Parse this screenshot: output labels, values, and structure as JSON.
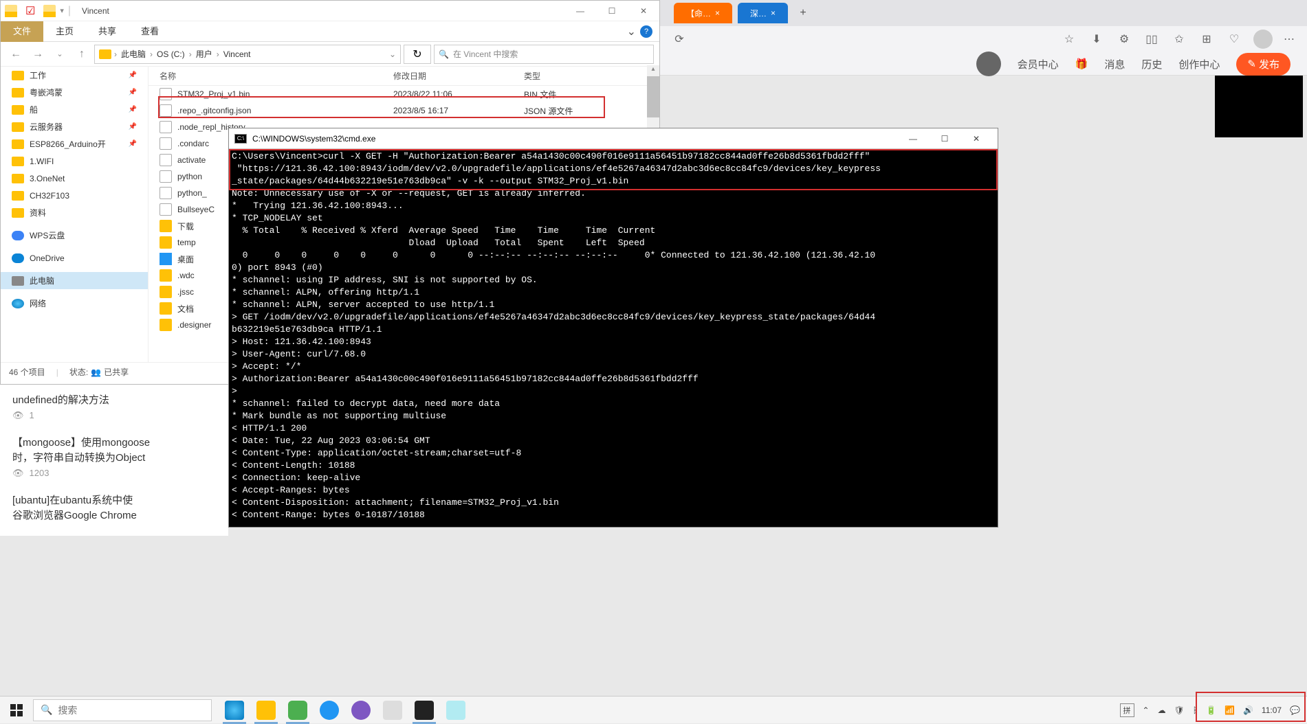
{
  "explorer": {
    "title": "Vincent",
    "ribbon": {
      "file": "文件",
      "home": "主页",
      "share": "共享",
      "view": "查看"
    },
    "breadcrumb": [
      "此电脑",
      "OS (C:)",
      "用户",
      "Vincent"
    ],
    "search_placeholder": "在 Vincent 中搜索",
    "headers": {
      "name": "名称",
      "date": "修改日期",
      "type": "类型"
    },
    "sidebar": [
      "工作",
      "粤嵌鸿蒙",
      "船",
      "云服务器",
      "ESP8266_Arduino开",
      "1.WIFI",
      "3.OneNet",
      "CH32F103",
      "资料"
    ],
    "sidebar_cloud": {
      "wps": "WPS云盘",
      "onedrive": "OneDrive"
    },
    "sidebar_pc": "此电脑",
    "sidebar_net": "网络",
    "files": [
      {
        "name": "STM32_Proj_v1.bin",
        "date": "2023/8/22 11:06",
        "type": "BIN 文件",
        "kind": "file"
      },
      {
        "name": ".repo_.gitconfig.json",
        "date": "2023/8/5 16:17",
        "type": "JSON 源文件",
        "kind": "file"
      },
      {
        "name": ".node_repl_history",
        "date": "",
        "type": "",
        "kind": "file"
      },
      {
        "name": ".condarc",
        "date": "",
        "type": "",
        "kind": "file"
      },
      {
        "name": "activate",
        "date": "",
        "type": "",
        "kind": "file"
      },
      {
        "name": "python",
        "date": "",
        "type": "",
        "kind": "file"
      },
      {
        "name": "python_",
        "date": "",
        "type": "",
        "kind": "file"
      },
      {
        "name": "BullseyeC",
        "date": "",
        "type": "",
        "kind": "file"
      },
      {
        "name": "下载",
        "date": "",
        "type": "",
        "kind": "folder"
      },
      {
        "name": "temp",
        "date": "",
        "type": "",
        "kind": "folder"
      },
      {
        "name": "桌面",
        "date": "",
        "type": "",
        "kind": "desktop"
      },
      {
        "name": ".wdc",
        "date": "",
        "type": "",
        "kind": "folder"
      },
      {
        "name": ".jssc",
        "date": "",
        "type": "",
        "kind": "folder"
      },
      {
        "name": "文档",
        "date": "",
        "type": "",
        "kind": "folder"
      },
      {
        "name": ".designer",
        "date": "",
        "type": "",
        "kind": "folder"
      }
    ],
    "status": {
      "count": "46 个项目",
      "state_label": "状态:",
      "shared": "已共享"
    }
  },
  "browser": {
    "tab1": "【命…",
    "tab2": "深…",
    "nav": {
      "vip": "会员中心",
      "msg": "消息",
      "history": "历史",
      "create": "创作中心",
      "publish": "发布"
    }
  },
  "articles": {
    "a1": "undefined的解决方法",
    "a1_meta": "1",
    "a2_l1": "【mongoose】使用mongoose",
    "a2_l2": "时，字符串自动转换为Object",
    "a2_meta": "1203",
    "a3_l1": "[ubantu]在ubantu系统中使",
    "a3_l2": "谷歌浏览器Google Chrome"
  },
  "cmd": {
    "title": "C:\\WINDOWS\\system32\\cmd.exe",
    "body": "C:\\Users\\Vincent>curl -X GET -H \"Authorization:Bearer a54a1430c00c490f016e9111a56451b97182cc844ad0ffe26b8d5361fbdd2fff\"\n \"https://121.36.42.100:8943/iodm/dev/v2.0/upgradefile/applications/ef4e5267a46347d2abc3d6ec8cc84fc9/devices/key_keypress\n_state/packages/64d44b632219e51e763db9ca\" -v -k --output STM32_Proj_v1.bin\nNote: Unnecessary use of -X or --request, GET is already inferred.\n*   Trying 121.36.42.100:8943...\n* TCP_NODELAY set\n  % Total    % Received % Xferd  Average Speed   Time    Time     Time  Current\n                                 Dload  Upload   Total   Spent    Left  Speed\n  0     0    0     0    0     0      0      0 --:--:-- --:--:-- --:--:--     0* Connected to 121.36.42.100 (121.36.42.10\n0) port 8943 (#0)\n* schannel: using IP address, SNI is not supported by OS.\n* schannel: ALPN, offering http/1.1\n* schannel: ALPN, server accepted to use http/1.1\n> GET /iodm/dev/v2.0/upgradefile/applications/ef4e5267a46347d2abc3d6ec8cc84fc9/devices/key_keypress_state/packages/64d44\nb632219e51e763db9ca HTTP/1.1\n> Host: 121.36.42.100:8943\n> User-Agent: curl/7.68.0\n> Accept: */*\n> Authorization:Bearer a54a1430c00c490f016e9111a56451b97182cc844ad0ffe26b8d5361fbdd2fff\n>\n* schannel: failed to decrypt data, need more data\n* Mark bundle as not supporting multiuse\n< HTTP/1.1 200\n< Date: Tue, 22 Aug 2023 03:06:54 GMT\n< Content-Type: application/octet-stream;charset=utf-8\n< Content-Length: 10188\n< Connection: keep-alive\n< Accept-Ranges: bytes\n< Content-Disposition: attachment; filename=STM32_Proj_v1.bin\n< Content-Range: bytes 0-10187/10188"
  },
  "taskbar": {
    "search": "搜索",
    "ime": "拼",
    "clock": "11:07"
  }
}
